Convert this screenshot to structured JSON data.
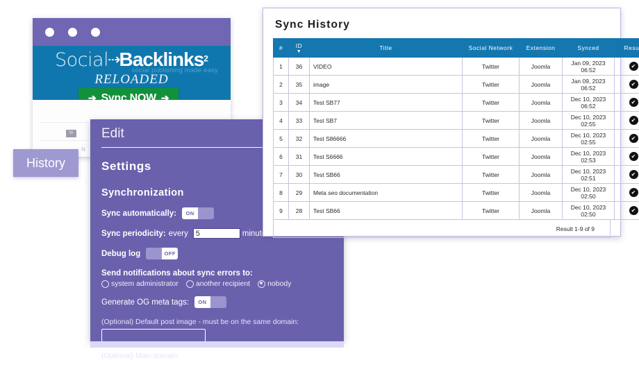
{
  "browser_mock": {
    "brand": {
      "social": "Social",
      "arrow_mark": "⇢",
      "backlinks": "Backlinks",
      "superscript": "2",
      "tagline": "social publishing made easy",
      "reloaded": "RELOADED"
    },
    "sync_now_button": {
      "left_arrow": "➔",
      "label": "Sync NOW",
      "right_arrow": "➔"
    },
    "badge_text": "W",
    "faint_text": "N"
  },
  "history_tab": {
    "label": "History"
  },
  "settings_dialog": {
    "title": "Edit",
    "settings_heading": "Settings",
    "sync_heading": "Synchronization",
    "sync_automatically": {
      "label": "Sync automatically:",
      "state": "ON"
    },
    "sync_periodicity": {
      "label_strong": "Sync periodicity:",
      "label_normal": "every",
      "value": "5",
      "suffix": "minutes"
    },
    "debug_log": {
      "label": "Debug log",
      "state": "OFF"
    },
    "notifications_heading": "Send notifications about sync errors to:",
    "notification_options": [
      {
        "label": "system administrator",
        "checked": false
      },
      {
        "label": "another recipient",
        "checked": false
      },
      {
        "label": "nobody",
        "checked": true
      }
    ],
    "generate_og": {
      "label": "Generate OG meta tags:",
      "state": "ON"
    },
    "default_post_image": {
      "label": "(Optional) Default post image - must be on the same domain:",
      "value": ""
    },
    "main_domain": {
      "label": "(Optional) Main domain:",
      "value": ""
    }
  },
  "sync_history": {
    "title": "Sync History",
    "columns": [
      "#",
      "ID",
      "Title",
      "Social Network",
      "Extension",
      "Synced",
      "Result"
    ],
    "sort_column": "ID",
    "sort_caret": "▼",
    "result_glyph": "✔",
    "rows": [
      {
        "num": "1",
        "id": "36",
        "title": "VIDEO",
        "network": "Twitter",
        "extension": "Joomla",
        "synced": "Jan 09, 2023 06:52",
        "result": "success"
      },
      {
        "num": "2",
        "id": "35",
        "title": "image",
        "network": "Twitter",
        "extension": "Joomla",
        "synced": "Jan 09, 2023 06:52",
        "result": "success"
      },
      {
        "num": "3",
        "id": "34",
        "title": "Test SB77",
        "network": "Twitter",
        "extension": "Joomla",
        "synced": "Dec 10, 2023 06:52",
        "result": "success"
      },
      {
        "num": "4",
        "id": "33",
        "title": "Test SB7",
        "network": "Twitter",
        "extension": "Joomla",
        "synced": "Dec 10, 2023 02:55",
        "result": "success"
      },
      {
        "num": "5",
        "id": "32",
        "title": "Test S86666",
        "network": "Twitter",
        "extension": "Joomla",
        "synced": "Dec 10, 2023 02:55",
        "result": "success"
      },
      {
        "num": "6",
        "id": "31",
        "title": "Test S6666",
        "network": "Twitter",
        "extension": "Joomla",
        "synced": "Dec 10, 2023 02:53",
        "result": "success"
      },
      {
        "num": "7",
        "id": "30",
        "title": "Test SB66",
        "network": "Twitter",
        "extension": "Joomla",
        "synced": "Dec 10, 2023 02:51",
        "result": "success"
      },
      {
        "num": "8",
        "id": "29",
        "title": "Meta seo documentation",
        "network": "Twitter",
        "extension": "Joomla",
        "synced": "Dec 10, 2023 02:50",
        "result": "success"
      },
      {
        "num": "9",
        "id": "28",
        "title": "Test SB66",
        "network": "Twitter",
        "extension": "Joomla",
        "synced": "Dec 10, 2023 02:50",
        "result": "success"
      }
    ],
    "footer": "Result 1-9 of 9"
  },
  "colors": {
    "purple": "#6a61ad",
    "purple_light": "#9f99d2",
    "brand_blue": "#1077ae",
    "table_header_blue": "#1477b0",
    "green": "#13913a"
  }
}
